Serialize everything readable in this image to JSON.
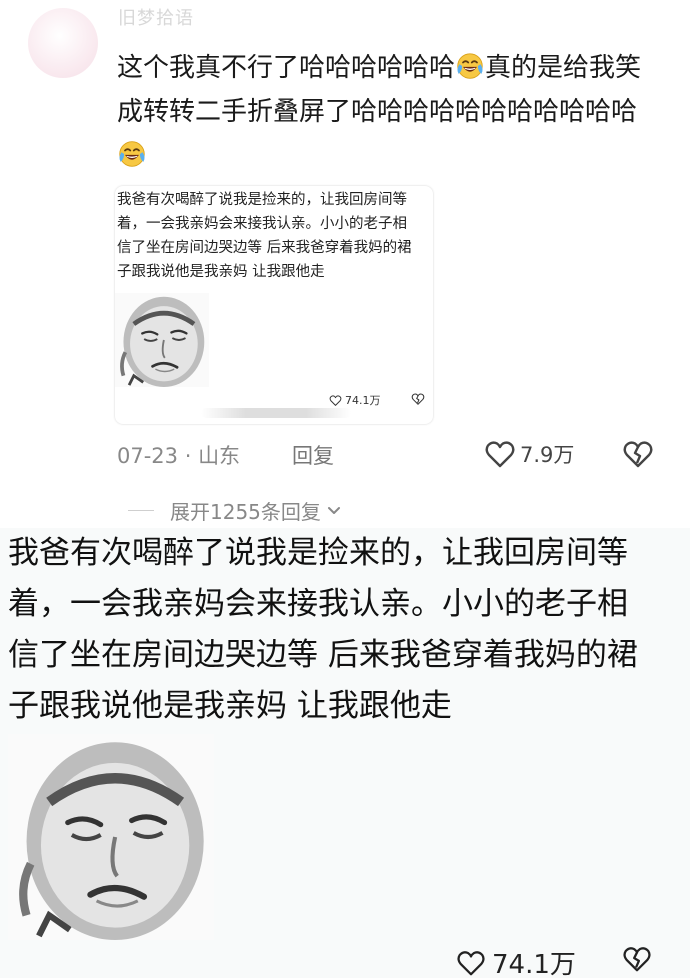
{
  "comment": {
    "username": "旧梦拾语",
    "text_part1": "这个我真不行了哈哈哈哈哈哈",
    "text_part2": "真的是给我笑成转转二手折叠屏了哈哈哈哈哈哈哈哈哈哈哈",
    "emoji_icon": "laugh-cry-icon",
    "date": "07-23",
    "location": "山东",
    "reply_label": "回复",
    "like_count": "7.9万",
    "expand_label": "展开1255条回复"
  },
  "card": {
    "text": "我爸有次喝醉了说我是捡来的，让我回房间等\n着，一会我亲妈会来接我认亲。小小的老子相\n信了坐在房间边哭边等 后来我爸穿着我妈的裙\n子跟我说他是我亲妈 让我跟他走",
    "like_count": "74.1万"
  },
  "zoom": {
    "text": "我爸有次喝醉了说我是捡来的，让我回房间等\n着，一会我亲妈会来接我认亲。小小的老子相\n信了坐在房间边哭边等 后来我爸穿着我妈的裙\n子跟我说他是我亲妈 让我跟他走",
    "like_count": "74.1万"
  },
  "colors": {
    "text_main": "#111111",
    "text_meta": "#888888",
    "emoji_yellow": "#f5c518",
    "tear_blue": "#4aa3e8"
  }
}
